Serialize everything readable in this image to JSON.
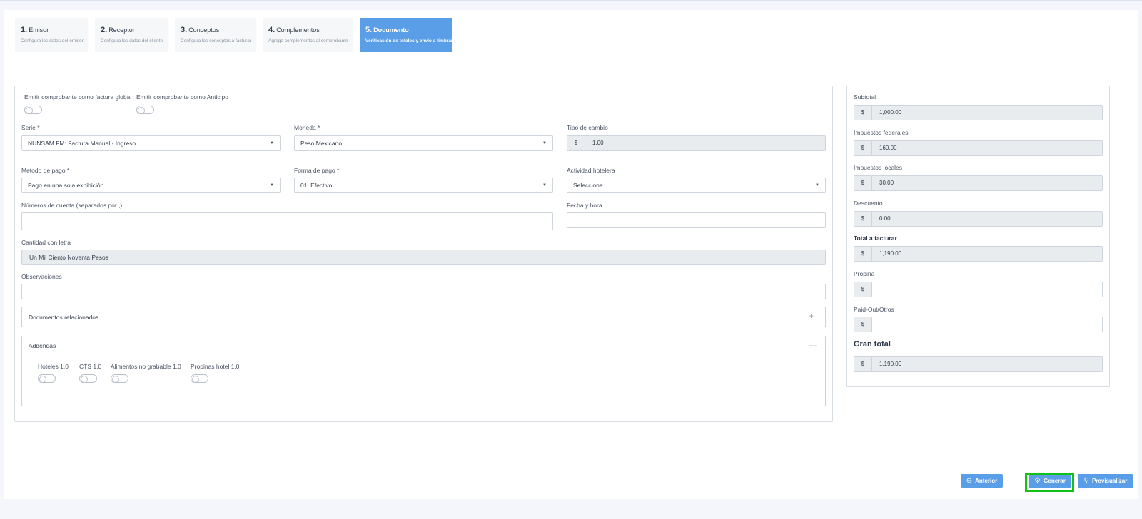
{
  "steps": [
    {
      "num": "1.",
      "title": "Emisor",
      "subtitle": "Configura los datos del emisor"
    },
    {
      "num": "2.",
      "title": "Receptor",
      "subtitle": "Configura los datos del cliente"
    },
    {
      "num": "3.",
      "title": "Conceptos",
      "subtitle": "Configura los conceptos a facturar"
    },
    {
      "num": "4.",
      "title": "Complementos",
      "subtitle": "Agrega complementos al comprobante"
    },
    {
      "num": "5.",
      "title": "Documento",
      "subtitle": "Verificación de totales y envío a timbrar"
    }
  ],
  "active_step": 5,
  "form": {
    "toggle_global_label": "Emitir comprobante como factura global",
    "toggle_anticipo_label": "Emitir comprobante como Anticipo",
    "serie_label": "Serie *",
    "serie_value": "NUNSAM FM: Factura Manual - Ingreso",
    "moneda_label": "Moneda *",
    "moneda_value": "Peso Mexicano",
    "tipo_cambio_label": "Tipo de cambio",
    "tipo_cambio_prefix": "$",
    "tipo_cambio_value": "1.00",
    "metodo_pago_label": "Metodo de pago *",
    "metodo_pago_value": "Pago en una sola exhibición",
    "forma_pago_label": "Forma de pago *",
    "forma_pago_value": "01: Efectivo",
    "actividad_label": "Actividad hotelera",
    "actividad_value": "Seleccione ...",
    "cuentas_label": "Números de cuenta (separados por ,)",
    "cuentas_value": "",
    "fecha_label": "Fecha y hora",
    "fecha_value": "",
    "cantidad_letra_label": "Cantidad con letra",
    "cantidad_letra_value": "Un Mil Ciento Noventa Pesos",
    "observaciones_label": "Observaciones",
    "observaciones_value": ""
  },
  "documentos_relacionados": {
    "title": "Documentos relacionados",
    "sign": "+"
  },
  "addendas": {
    "title": "Addendas",
    "sign": "—",
    "items": [
      "Hoteles 1.0",
      "CTS 1.0",
      "Alimentos no grabable 1.0",
      "Propinas hotel 1.0"
    ]
  },
  "totals": {
    "currency_symbol": "$",
    "subtotal_label": "Subtotal",
    "subtotal_value": "1,000.00",
    "imp_fed_label": "Impuestos federales",
    "imp_fed_value": "160.00",
    "imp_loc_label": "Impuestos locales",
    "imp_loc_value": "30.00",
    "descuento_label": "Descuento",
    "descuento_value": "0.00",
    "total_label": "Total a facturar",
    "total_value": "1,190.00",
    "propina_label": "Propina",
    "propina_value": "",
    "paidout_label": "Paid-Out/Otros",
    "paidout_value": "",
    "gran_total_label": "Gran total",
    "gran_total_value": "1,190.00"
  },
  "buttons": {
    "anterior": "Anterior",
    "generar": "Generar",
    "previsualizar": "Previsualizar"
  },
  "icons": {
    "anterior": "circle-arrow-left-icon",
    "generar": "gear-icon",
    "previsualizar": "search-icon"
  },
  "colors": {
    "accent": "#5a9ee8",
    "highlight": "#10c215"
  }
}
